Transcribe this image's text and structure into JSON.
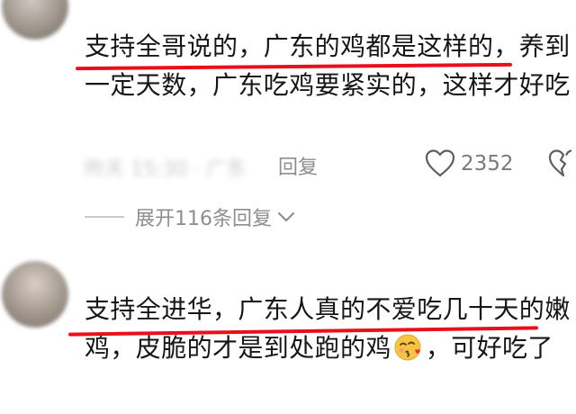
{
  "comment1": {
    "text": "支持全哥说的，广东的鸡都是这样的，养到一定天数，广东吃鸡要紧实的，这样才好吃",
    "meta_blurred": "昨天 15:30 · 广东",
    "reply_label": "回复",
    "like_count": "2352"
  },
  "expand": {
    "label": "展开116条回复"
  },
  "comment2": {
    "text_before_emoji": "支持全进华，广东人真的不爱吃几十天的嫩鸡，皮脆的才是到处跑的鸡",
    "text_after_emoji": "，可好吃了"
  },
  "colors": {
    "highlight": "#e8101a",
    "meta": "#8a8a8a"
  },
  "icons": [
    "heart-outline-icon",
    "broken-heart-icon",
    "chevron-down-icon",
    "blowing-kiss-emoji-icon"
  ]
}
